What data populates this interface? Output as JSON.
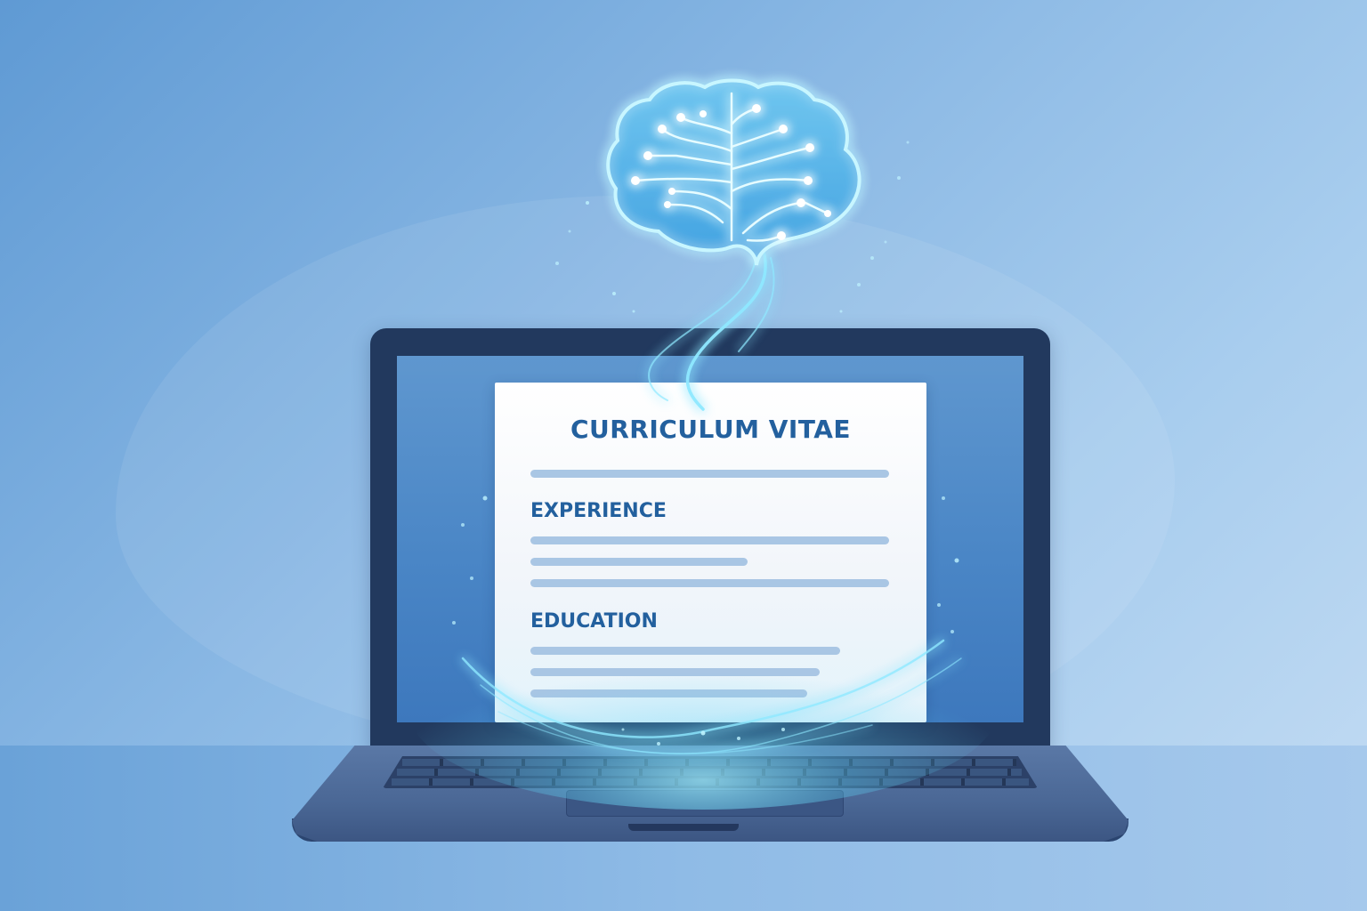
{
  "cv": {
    "title": "CURRICULUM VITAE",
    "sections": [
      {
        "heading": "EXPERIENCE"
      },
      {
        "heading": "EDUCATION"
      }
    ]
  },
  "icons": {
    "brain": "brain-circuit-icon"
  },
  "colors": {
    "background": "#8ab8e4",
    "laptop_frame": "#22395e",
    "screen": "#4a86c6",
    "document_text": "#23609e",
    "glow": "#7fe3ff"
  }
}
